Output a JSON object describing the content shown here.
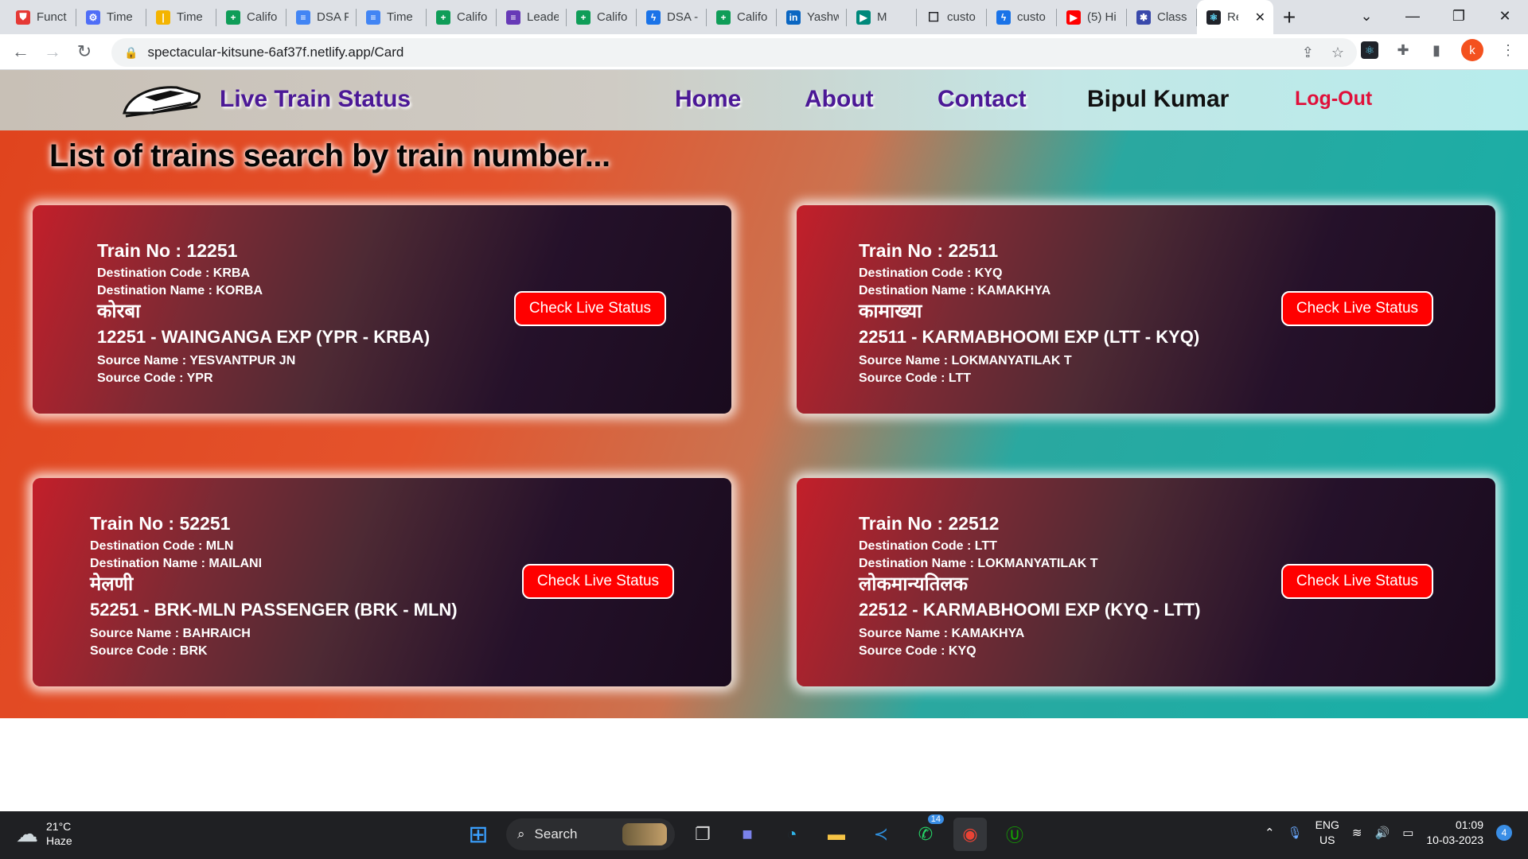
{
  "browser": {
    "tabs": [
      {
        "title": "Funct",
        "icon": "red-shield-icon",
        "color": "#e53935",
        "glyph": "⛊"
      },
      {
        "title": "Time",
        "icon": "gear-icon",
        "color": "#4f6ef7",
        "glyph": "⚙"
      },
      {
        "title": "Time",
        "icon": "bar-icon",
        "color": "#f4b400",
        "glyph": "|"
      },
      {
        "title": "Califo",
        "icon": "sheets-icon",
        "color": "#0f9d58",
        "glyph": "+"
      },
      {
        "title": "DSA F",
        "icon": "docs-icon",
        "color": "#4285f4",
        "glyph": "≡"
      },
      {
        "title": "Time",
        "icon": "docs-icon",
        "color": "#4285f4",
        "glyph": "≡"
      },
      {
        "title": "Califo",
        "icon": "sheets-icon",
        "color": "#0f9d58",
        "glyph": "+"
      },
      {
        "title": "Leade",
        "icon": "forms-icon",
        "color": "#673ab7",
        "glyph": "≡"
      },
      {
        "title": "Califo",
        "icon": "sheets-icon",
        "color": "#0f9d58",
        "glyph": "+"
      },
      {
        "title": "DSA -",
        "icon": "bolt-icon",
        "color": "#1a73e8",
        "glyph": "ϟ"
      },
      {
        "title": "Califo",
        "icon": "sheets-icon",
        "color": "#0f9d58",
        "glyph": "+"
      },
      {
        "title": "Yashw",
        "icon": "linkedin-icon",
        "color": "#0a66c2",
        "glyph": "in"
      },
      {
        "title": "M",
        "icon": "meet-icon",
        "color": "#00897b",
        "glyph": "▶"
      },
      {
        "title": "custo",
        "icon": "square-icon",
        "color": "#ffffff",
        "glyph": "☐"
      },
      {
        "title": "custo",
        "icon": "bolt-icon",
        "color": "#1a73e8",
        "glyph": "ϟ"
      },
      {
        "title": "(5) Hi",
        "icon": "youtube-icon",
        "color": "#ff0000",
        "glyph": "▶"
      },
      {
        "title": "Class",
        "icon": "class-icon",
        "color": "#3949ab",
        "glyph": "✱"
      }
    ],
    "active_tab": {
      "title": "Re",
      "icon": "react-icon"
    },
    "url": "spectacular-kitsune-6af37f.netlify.app/Card",
    "avatar_letter": "k"
  },
  "site": {
    "brand": "Live Train Status",
    "nav": {
      "home": "Home",
      "about": "About",
      "contact": "Contact",
      "user": "Bipul Kumar",
      "logout": "Log-Out"
    },
    "heading": "List of trains search by train number...",
    "check_label": "Check Live Status",
    "cards": [
      {
        "train_no": "Train No : 12251",
        "dest_code": "Destination Code : KRBA",
        "dest_name": "Destination Name : KORBA",
        "hindi": "कोरबा",
        "train_name": "12251 - WAINGANGA EXP (YPR - KRBA)",
        "source_name": "Source Name : YESVANTPUR JN",
        "source_code": "Source Code : YPR"
      },
      {
        "train_no": "Train No : 22511",
        "dest_code": "Destination Code : KYQ",
        "dest_name": "Destination Name : KAMAKHYA",
        "hindi": "कामाख्या",
        "train_name": "22511 - KARMABHOOMI EXP (LTT - KYQ)",
        "source_name": "Source Name : LOKMANYATILAK T",
        "source_code": "Source Code : LTT"
      },
      {
        "train_no": "Train No : 52251",
        "dest_code": "Destination Code : MLN",
        "dest_name": "Destination Name : MAILANI",
        "hindi": "मेलणी",
        "train_name": "52251 - BRK-MLN PASSENGER (BRK - MLN)",
        "source_name": "Source Name : BAHRAICH",
        "source_code": "Source Code : BRK"
      },
      {
        "train_no": "Train No : 22512",
        "dest_code": "Destination Code : LTT",
        "dest_name": "Destination Name : LOKMANYATILAK T",
        "hindi": "लोकमान्यतिलक",
        "train_name": "22512 - KARMABHOOMI EXP (KYQ - LTT)",
        "source_name": "Source Name : KAMAKHYA",
        "source_code": "Source Code : KYQ"
      }
    ]
  },
  "taskbar": {
    "temp": "21°C",
    "weather": "Haze",
    "search_label": "Search",
    "whatsapp_badge": "14",
    "lang_1": "ENG",
    "lang_2": "US",
    "time": "01:09",
    "date": "10-03-2023",
    "notifications": "4"
  }
}
